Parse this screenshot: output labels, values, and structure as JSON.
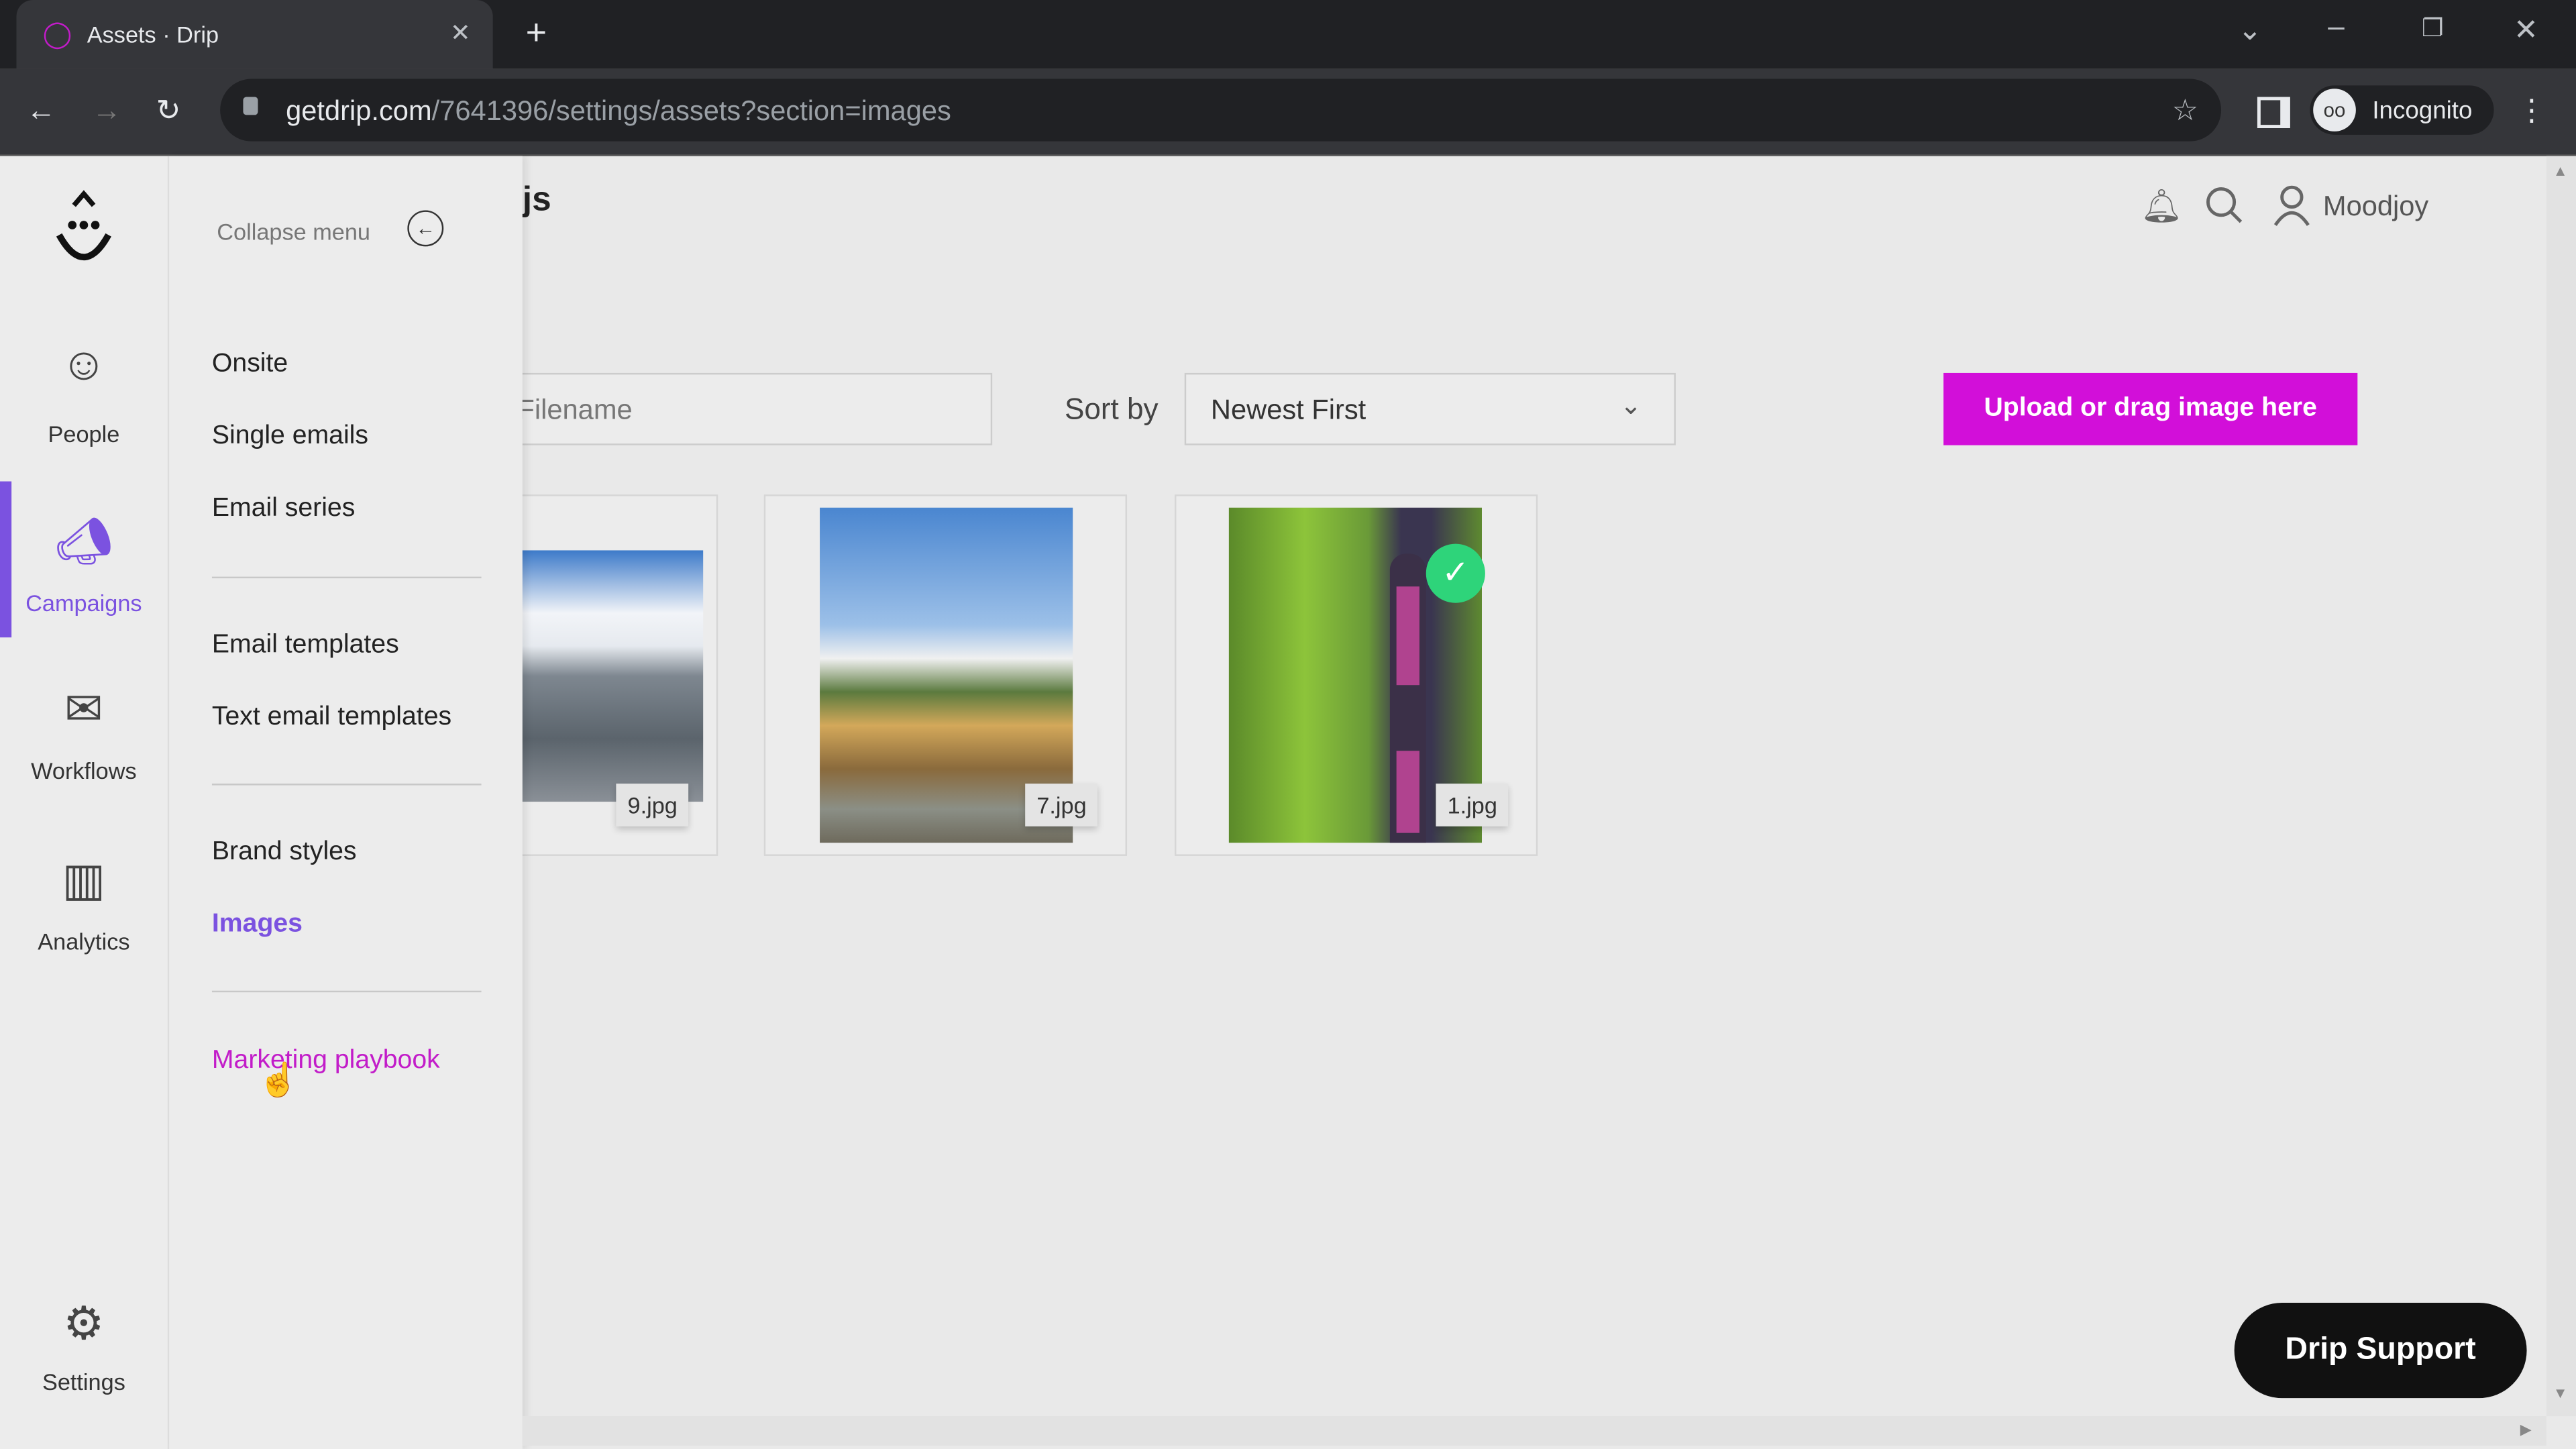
{
  "browser": {
    "tab_title": "Assets · Drip",
    "url_domain": "getdrip.com",
    "url_path": "/7641396/settings/assets?section=images",
    "profile_label": "Incognito"
  },
  "header": {
    "title_partial": "js",
    "username": "Moodjoy"
  },
  "rail": {
    "items": [
      {
        "label": "People",
        "icon": "people-icon"
      },
      {
        "label": "Campaigns",
        "icon": "megaphone-icon",
        "active": true
      },
      {
        "label": "Workflows",
        "icon": "workflow-icon"
      },
      {
        "label": "Analytics",
        "icon": "analytics-icon"
      },
      {
        "label": "Settings",
        "icon": "gear-icon"
      }
    ]
  },
  "menu": {
    "collapse_label": "Collapse menu",
    "items": [
      {
        "label": "Onsite"
      },
      {
        "label": "Single emails"
      },
      {
        "label": "Email series"
      },
      {
        "label": "Email templates"
      },
      {
        "label": "Text email templates"
      },
      {
        "label": "Brand styles"
      },
      {
        "label": "Images",
        "active": true
      },
      {
        "label": "Marketing playbook",
        "hovered": true
      }
    ]
  },
  "toolbar": {
    "filename_placeholder": "Filename",
    "sort_label": "Sort by",
    "sort_value": "Newest First",
    "upload_label": "Upload or drag image here"
  },
  "images": [
    {
      "filename": "9.jpg"
    },
    {
      "filename": "7.jpg"
    },
    {
      "filename": "1.jpg",
      "selected": true
    }
  ],
  "support_label": "Drip Support",
  "colors": {
    "accent_purple": "#7b52e0",
    "upload_magenta": "#d20fd9",
    "playbook_magenta": "#c21cc9",
    "check_green": "#2ed47a"
  }
}
